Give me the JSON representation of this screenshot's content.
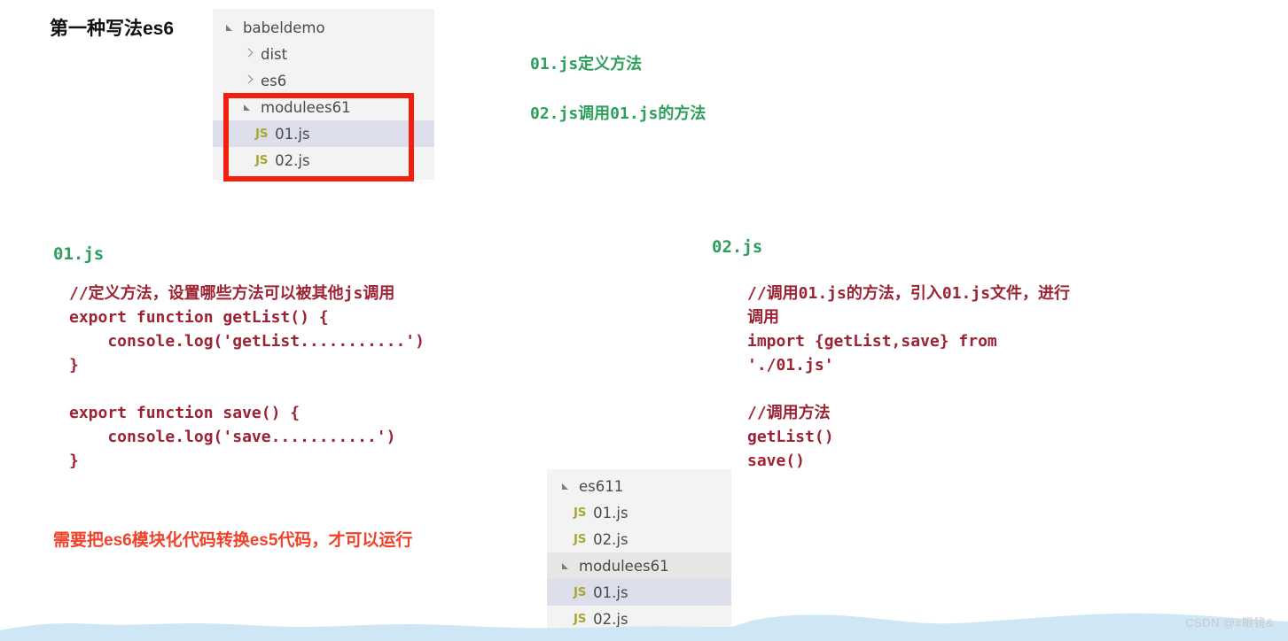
{
  "slide": {
    "title": "第一种写法es6"
  },
  "file_tree_top": {
    "rows": [
      {
        "label": "babeldemo",
        "type": "folder",
        "twisty": "open",
        "indent": 0,
        "state": "normal"
      },
      {
        "label": "dist",
        "type": "folder",
        "twisty": "closed",
        "indent": 1,
        "state": "normal"
      },
      {
        "label": "es6",
        "type": "folder",
        "twisty": "closed",
        "indent": 1,
        "state": "normal"
      },
      {
        "label": "modulees61",
        "type": "folder",
        "twisty": "open",
        "indent": 1,
        "state": "normal"
      },
      {
        "label": "01.js",
        "type": "file",
        "icon": "js-file-icon",
        "icon_text": "JS",
        "indent": 2,
        "state": "selected"
      },
      {
        "label": "02.js",
        "type": "file",
        "icon": "js-file-icon",
        "icon_text": "JS",
        "indent": 2,
        "state": "normal"
      }
    ],
    "highlight_box_color": "#f21f0c"
  },
  "file_tree_bottom": {
    "rows": [
      {
        "label": "es611",
        "type": "folder",
        "twisty": "open",
        "indent": 0,
        "state": "normal"
      },
      {
        "label": "01.js",
        "type": "file",
        "icon": "js-file-icon",
        "icon_text": "JS",
        "indent": 1,
        "state": "normal"
      },
      {
        "label": "02.js",
        "type": "file",
        "icon": "js-file-icon",
        "icon_text": "JS",
        "indent": 1,
        "state": "normal"
      },
      {
        "label": "modulees61",
        "type": "folder",
        "twisty": "open",
        "indent": 0,
        "state": "hover"
      },
      {
        "label": "01.js",
        "type": "file",
        "icon": "js-file-icon",
        "icon_text": "JS",
        "indent": 1,
        "state": "selected"
      },
      {
        "label": "02.js",
        "type": "file",
        "icon": "js-file-icon",
        "icon_text": "JS",
        "indent": 1,
        "state": "normal"
      }
    ]
  },
  "notes": {
    "note_01": "01.js定义方法",
    "note_02": "02.js调用01.js的方法",
    "warning": "需要把es6模块化代码转换es5代码，才可以运行"
  },
  "code_left": {
    "heading": "01.js",
    "body": "//定义方法，设置哪些方法可以被其他js调用\nexport function getList() {\n    console.log('getList...........')\n}\n\nexport function save() {\n    console.log('save...........')\n}"
  },
  "code_right": {
    "heading": "02.js",
    "body": "//调用01.js的方法，引入01.js文件，进行调用\nimport {getList,save} from './01.js'\n\n//调用方法\ngetList()\nsave()"
  },
  "colors": {
    "accent_green": "#2e9e5b",
    "code_dark_red": "#9c2333",
    "warning_red": "#f0412a",
    "highlight_red": "#f21f0c",
    "js_icon_olive": "#a8a832",
    "tree_bg": "#f3f3f3",
    "tree_selected_bg": "#dcdfeb",
    "tree_hover_bg": "#e6e6e6",
    "wave_blue": "#cfe7f5"
  },
  "watermark": {
    "text": "CSDN @#眼镜&"
  }
}
